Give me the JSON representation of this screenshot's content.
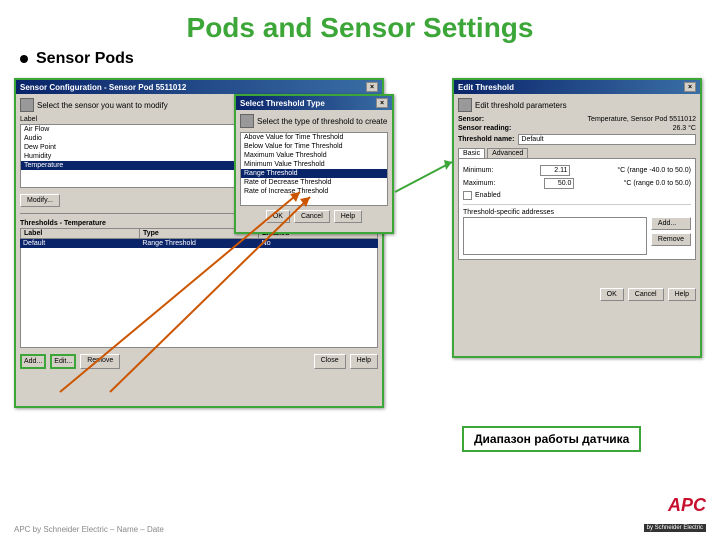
{
  "slide": {
    "title": "Pods and Sensor Settings",
    "bullet": "Sensor Pods",
    "callout": "Диапазон работы датчика",
    "footer": "APC by Schneider Electric – Name – Date",
    "logo_main": "APC",
    "logo_sub": "by Schneider Electric"
  },
  "win1": {
    "title": "Sensor Configuration - Sensor Pod 5511012",
    "instr": "Select the sensor you want to modify",
    "group1": "Label",
    "items": [
      "Air Flow",
      "Audio",
      "Dew Point",
      "Humidity",
      "Temperature"
    ],
    "btn_modify": "Modify...",
    "thresholds_group": "Thresholds - Temperature",
    "cols": {
      "c1": "Label",
      "c2": "Type",
      "c3": "Enabled"
    },
    "row": {
      "c1": "Default",
      "c2": "Range Threshold",
      "c3": "No"
    },
    "btn_add": "Add...",
    "btn_edit": "Edit...",
    "btn_remove": "Remove",
    "btn_close": "Close",
    "btn_help": "Help"
  },
  "win2": {
    "title": "Select Threshold Type",
    "instr": "Select the type of threshold to create",
    "items": [
      "Above Value for Time Threshold",
      "Below Value for Time Threshold",
      "Maximum Value Threshold",
      "Minimum Value Threshold",
      "Range Threshold",
      "Rate of Decrease Threshold",
      "Rate of Increase Threshold"
    ],
    "btn_ok": "OK",
    "btn_cancel": "Cancel",
    "btn_help": "Help"
  },
  "win3": {
    "title": "Edit Threshold",
    "instr": "Edit threshold parameters",
    "sensor_lbl": "Sensor:",
    "sensor_val": "Temperature, Sensor Pod 5511012",
    "reading_lbl": "Sensor reading:",
    "reading_val": "26.3 °C",
    "thname_lbl": "Threshold name:",
    "thname_val": "Default",
    "tab_basic": "Basic",
    "tab_adv": "Advanced",
    "min_lbl": "Minimum:",
    "min_val": "2.11",
    "min_unit": "°C (range -40.0 to 50.0)",
    "max_lbl": "Maximum:",
    "max_val": "50.0",
    "max_unit": "°C (range 0.0 to 50.0)",
    "enabled_lbl": "Enabled",
    "email_group": "Threshold-specific addresses",
    "btn_addr_add": "Add...",
    "btn_addr_rem": "Remove",
    "btn_ok": "OK",
    "btn_cancel": "Cancel",
    "btn_help": "Help"
  }
}
